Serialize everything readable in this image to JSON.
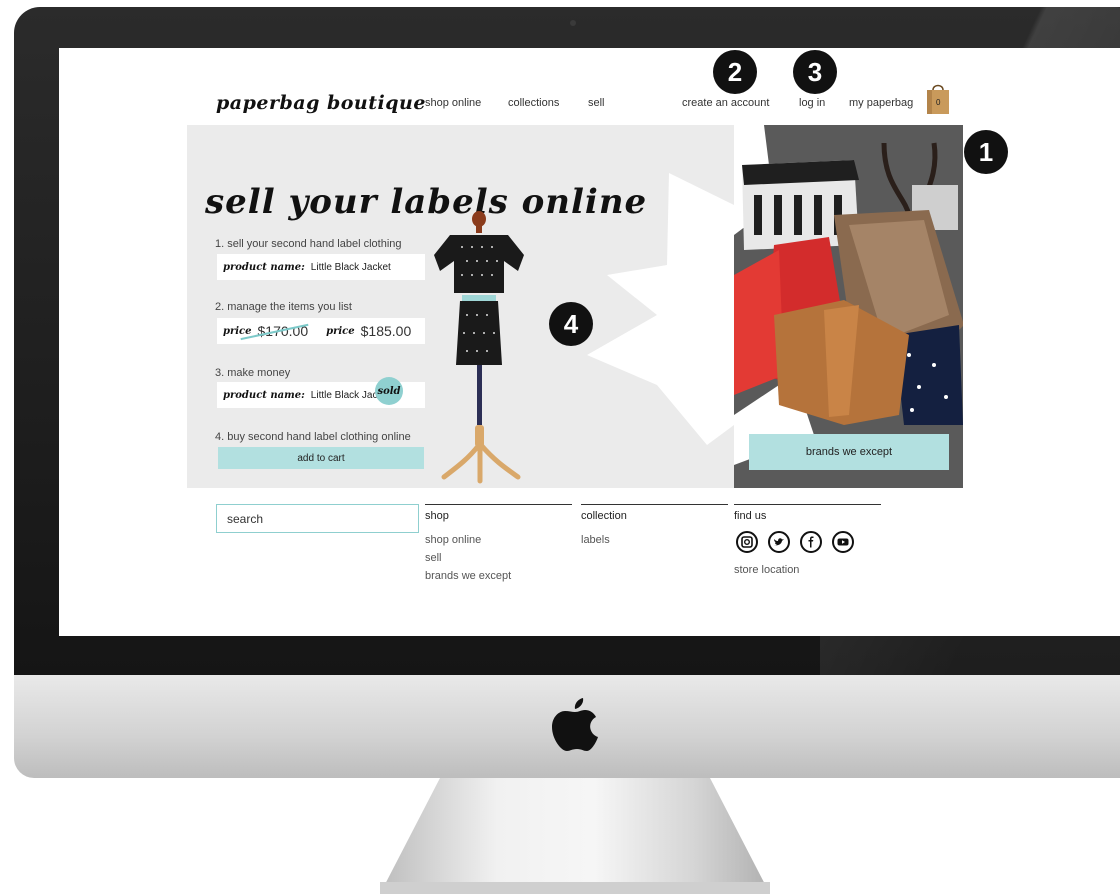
{
  "header": {
    "logo": "paperbag boutique",
    "nav": [
      "shop online",
      "collections",
      "sell"
    ],
    "create_account": "create an account",
    "log_in": "log in",
    "my_bag": "my paperbag",
    "bag_count": "0"
  },
  "badges": {
    "one": "1",
    "two": "2",
    "three": "3",
    "four": "4"
  },
  "hero": {
    "title": "sell your labels online",
    "steps": [
      {
        "text": "1. sell your second hand label clothing",
        "label": "product name:",
        "value": "Little Black Jacket"
      },
      {
        "text": "2. manage the items you list",
        "price_label": "price",
        "old_price": "$170.00",
        "new_price": "$185.00"
      },
      {
        "text": "3. make money",
        "label": "product name:",
        "value": "Little Black Jac",
        "stamp": "sold"
      },
      {
        "text": "4. buy second hand label clothing online",
        "button": "add to cart"
      }
    ]
  },
  "collage": {
    "button": "brands we except"
  },
  "footer": {
    "search_placeholder": "search",
    "shop": {
      "heading": "shop",
      "links": [
        "shop online",
        "sell",
        "brands we except"
      ]
    },
    "collection": {
      "heading": "collection",
      "links": [
        "labels"
      ]
    },
    "find_us": {
      "heading": "find us",
      "store_location": "store location",
      "social": [
        "instagram-icon",
        "twitter-icon",
        "facebook-icon",
        "youtube-icon"
      ]
    }
  },
  "colors": {
    "accent": "#b2e0e0",
    "hero_bg": "#ebebeb",
    "collage_bg": "#555555",
    "bezel": "#1c1c1c"
  }
}
